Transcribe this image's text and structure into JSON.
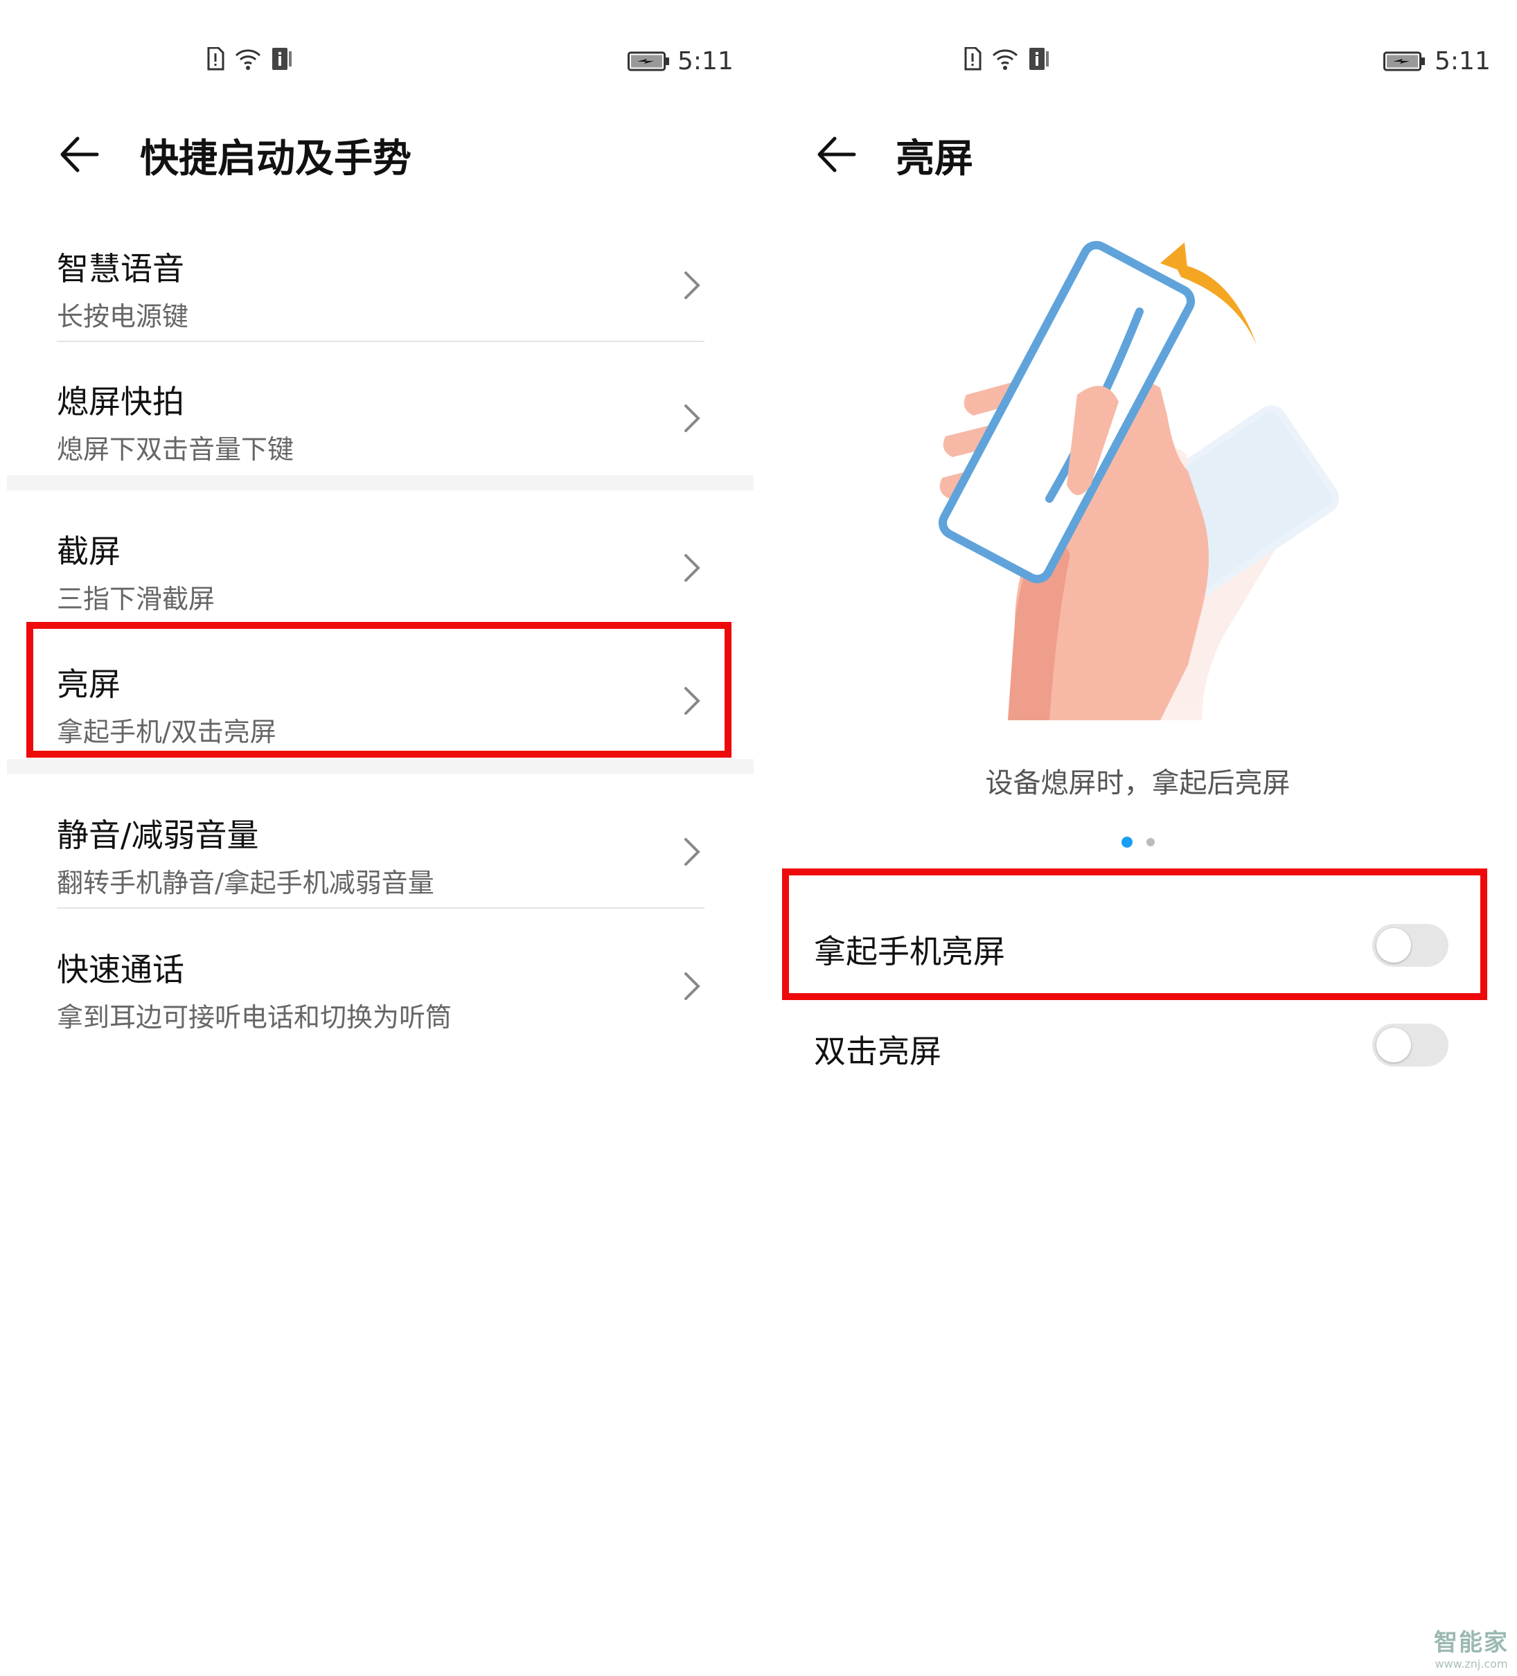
{
  "left": {
    "status": {
      "time": "5:11"
    },
    "title": "快捷启动及手势",
    "items": [
      {
        "title": "智慧语音",
        "subtitle": "长按电源键"
      },
      {
        "title": "熄屏快拍",
        "subtitle": "熄屏下双击音量下键"
      },
      {
        "title": "截屏",
        "subtitle": "三指下滑截屏"
      },
      {
        "title": "亮屏",
        "subtitle": "拿起手机/双击亮屏"
      },
      {
        "title": "静音/减弱音量",
        "subtitle": "翻转手机静音/拿起手机减弱音量"
      },
      {
        "title": "快速通话",
        "subtitle": "拿到耳边可接听电话和切换为听筒"
      }
    ]
  },
  "right": {
    "status": {
      "time": "5:11"
    },
    "title": "亮屏",
    "caption": "设备熄屏时，拿起后亮屏",
    "pager": {
      "current": 1,
      "total": 2
    },
    "toggles": [
      {
        "label": "拿起手机亮屏",
        "on": false
      },
      {
        "label": "双击亮屏",
        "on": false
      }
    ]
  },
  "watermark": {
    "name": "智能家",
    "url": "www.znj.com"
  },
  "colors": {
    "highlight": "#ee0a0a",
    "accent": "#1a9ef5",
    "arrow": "#f4a623",
    "phone": "#5fa3da",
    "hand": "#f7b9a6"
  }
}
